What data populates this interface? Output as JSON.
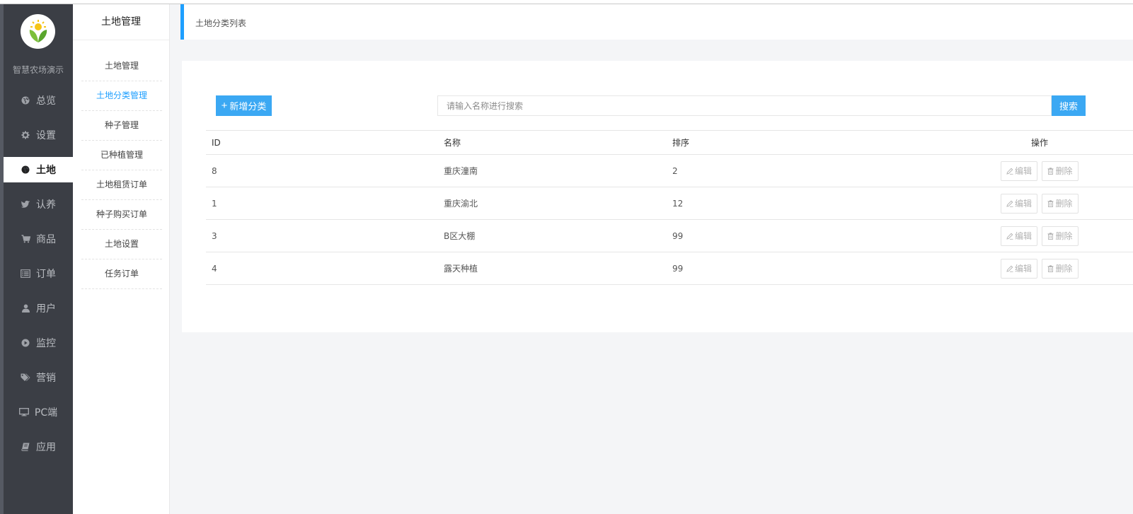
{
  "brand": {
    "name": "智慧农场演示",
    "logo_icon": "sunflower-logo-icon"
  },
  "sidebar": {
    "items": [
      {
        "label": "总览",
        "icon": "globe-icon"
      },
      {
        "label": "设置",
        "icon": "gear-icon"
      },
      {
        "label": "土地",
        "icon": "globe-icon",
        "active": true
      },
      {
        "label": "认养",
        "icon": "bird-icon"
      },
      {
        "label": "商品",
        "icon": "cart-icon"
      },
      {
        "label": "订单",
        "icon": "list-icon"
      },
      {
        "label": "用户",
        "icon": "user-icon"
      },
      {
        "label": "监控",
        "icon": "play-circle-icon"
      },
      {
        "label": "营销",
        "icon": "tags-icon"
      },
      {
        "label": "PC端",
        "icon": "monitor-icon"
      },
      {
        "label": "应用",
        "icon": "book-icon"
      }
    ]
  },
  "subnav": {
    "title": "土地管理",
    "items": [
      {
        "label": "土地管理"
      },
      {
        "label": "土地分类管理",
        "active": true
      },
      {
        "label": "种子管理"
      },
      {
        "label": "已种植管理"
      },
      {
        "label": "土地租赁订单"
      },
      {
        "label": "种子购买订单"
      },
      {
        "label": "土地设置"
      },
      {
        "label": "任务订单"
      }
    ]
  },
  "breadcrumb": {
    "title": "土地分类列表"
  },
  "toolbar": {
    "add_label": "新增分类",
    "search_placeholder": "请输入名称进行搜索",
    "search_label": "搜索"
  },
  "table": {
    "headers": {
      "id": "ID",
      "name": "名称",
      "sort": "排序",
      "ops": "操作"
    },
    "rows": [
      {
        "id": "8",
        "name": "重庆潼南",
        "sort": "2"
      },
      {
        "id": "1",
        "name": "重庆渝北",
        "sort": "12"
      },
      {
        "id": "3",
        "name": "B区大棚",
        "sort": "99"
      },
      {
        "id": "4",
        "name": "露天种植",
        "sort": "99"
      }
    ],
    "edit_label": "编辑",
    "delete_label": "删除"
  },
  "colors": {
    "accent": "#1e9fff",
    "button": "#3ba8f3",
    "sidebar_bg": "#3b3e45"
  }
}
